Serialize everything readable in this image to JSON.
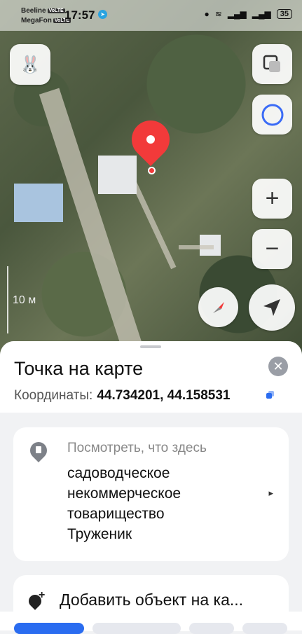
{
  "status_bar": {
    "operator1": "Beeline",
    "operator2": "MegaFon",
    "net_tag": "VoLTE",
    "time": "17:57",
    "battery": "35"
  },
  "map": {
    "scale_label": "10 м",
    "icons": [
      "layers-icon",
      "alice-icon",
      "plus-icon",
      "minus-icon",
      "compass-icon",
      "locate-icon"
    ]
  },
  "sheet": {
    "title": "Точка на карте",
    "coords_label": "Координаты:",
    "coords_value": "44.734201, 44.158531",
    "whats_here_label": "Посмотреть, что здесь",
    "place_name": "садоводческое\nнекоммерческое\nтоварищество\nТруженик",
    "add_object": "Добавить объект на ка..."
  },
  "colors": {
    "pin": "#f23a3a",
    "accent": "#2a6cf0"
  }
}
